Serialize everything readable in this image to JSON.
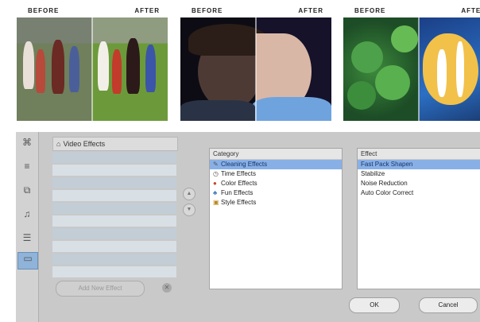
{
  "comparisons": [
    {
      "before_label": "BEFORE",
      "after_label": "AFTER"
    },
    {
      "before_label": "BEFORE",
      "after_label": "AFTER"
    },
    {
      "before_label": "BEFORE",
      "after_label": "AFTER"
    }
  ],
  "dialog": {
    "effects_panel": {
      "header": "Video Effects",
      "icon": "video-effects-icon",
      "add_button_label": "Add New Effect"
    },
    "category_list": {
      "header": "Category",
      "items": [
        {
          "label": "Cleaning Effects",
          "icon": "brush-icon",
          "selected": true
        },
        {
          "label": "Time Effects",
          "icon": "clock-icon",
          "selected": false
        },
        {
          "label": "Color Effects",
          "icon": "palette-icon",
          "selected": false
        },
        {
          "label": "Fun Effects",
          "icon": "figure-icon",
          "selected": false
        },
        {
          "label": "Style Effects",
          "icon": "frame-icon",
          "selected": false
        }
      ]
    },
    "effect_list": {
      "header": "Effect",
      "items": [
        {
          "label": "Fast Pack Shapen",
          "selected": true
        },
        {
          "label": "Stabilize",
          "selected": false
        },
        {
          "label": "Noise Reduction",
          "selected": false
        },
        {
          "label": "Auto Color Correct",
          "selected": false
        }
      ]
    },
    "ok_label": "OK",
    "cancel_label": "Cancel",
    "colors": {
      "selection": "#88b0e6",
      "background": "#c9c9c9"
    }
  }
}
